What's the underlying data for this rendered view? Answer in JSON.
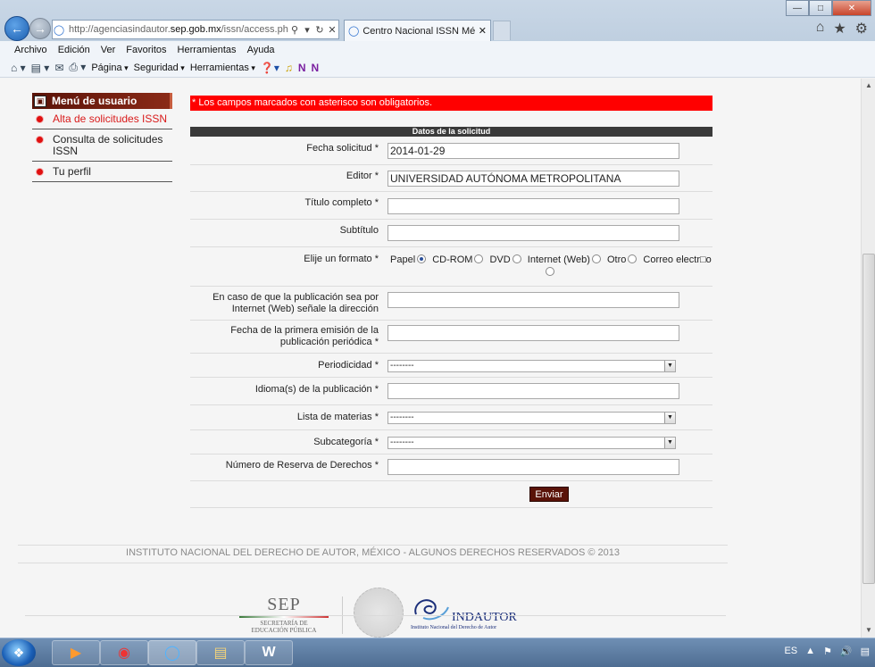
{
  "browser": {
    "address_prefix": "http://agenciasindautor.",
    "address_domain": "sep.gob.mx",
    "address_suffix": "/issn/access.php#n",
    "tab_title": "Centro Nacional ISSN México"
  },
  "menubar": [
    "Archivo",
    "Edición",
    "Ver",
    "Favoritos",
    "Herramientas",
    "Ayuda"
  ],
  "commandbar": {
    "page": "Página",
    "security": "Seguridad",
    "tools": "Herramientas"
  },
  "sidemenu": {
    "title": "Menú de usuario",
    "items": [
      {
        "label": "Alta de solicitudes ISSN",
        "active": true
      },
      {
        "label": "Consulta de solicitudes ISSN",
        "active": false
      },
      {
        "label": "Tu perfil",
        "active": false
      }
    ]
  },
  "form": {
    "alert": "* Los campos marcados con asterisco son obligatorios.",
    "section_title": "Datos de la solicitud",
    "fields": {
      "fecha": {
        "label": "Fecha solicitud *",
        "value": "2014-01-29"
      },
      "editor": {
        "label": "Editor *",
        "value": "UNIVERSIDAD AUTÓNOMA METROPOLITANA"
      },
      "titulo": {
        "label": "Título completo *",
        "value": ""
      },
      "subtitulo": {
        "label": "Subtítulo",
        "value": ""
      },
      "formato": {
        "label": "Elije un formato *",
        "options": [
          "Papel",
          "CD-ROM",
          "DVD",
          "Internet (Web)",
          "Otro",
          "Correo electr□o"
        ],
        "selected": "Papel"
      },
      "direccion": {
        "label_line1": "En caso de que la publicación sea por",
        "label_line2": "Internet (Web) señale la dirección",
        "value": ""
      },
      "primera_emision": {
        "label_line1": "Fecha de la primera emisión de la",
        "label_line2": "publicación periódica *",
        "value": ""
      },
      "periodicidad": {
        "label": "Periodicidad *",
        "value": "--------"
      },
      "idioma": {
        "label": "Idioma(s) de la publicación *",
        "value": ""
      },
      "materias": {
        "label": "Lista de materias *",
        "value": "--------"
      },
      "subcategoria": {
        "label": "Subcategoría *",
        "value": "--------"
      },
      "reserva": {
        "label": "Número de Reserva de Derechos *",
        "value": ""
      }
    },
    "submit_label": "Enviar"
  },
  "footer": {
    "copyright": "INSTITUTO NACIONAL DEL DERECHO DE AUTOR, MÉXICO - ALGUNOS DERECHOS RESERVADOS © 2013",
    "sep_big": "SEP",
    "sep_line1": "SECRETARÍA DE",
    "sep_line2": "EDUCACIÓN PÚBLICA",
    "indautor_name": "INDAUTOR",
    "indautor_sub": "Instituto Nacional del Derecho de Autor"
  },
  "taskbar": {
    "language": "ES"
  },
  "colors": {
    "alert_red": "#ff0000",
    "maroon": "#5a1308",
    "active_link": "#d91a1a"
  }
}
